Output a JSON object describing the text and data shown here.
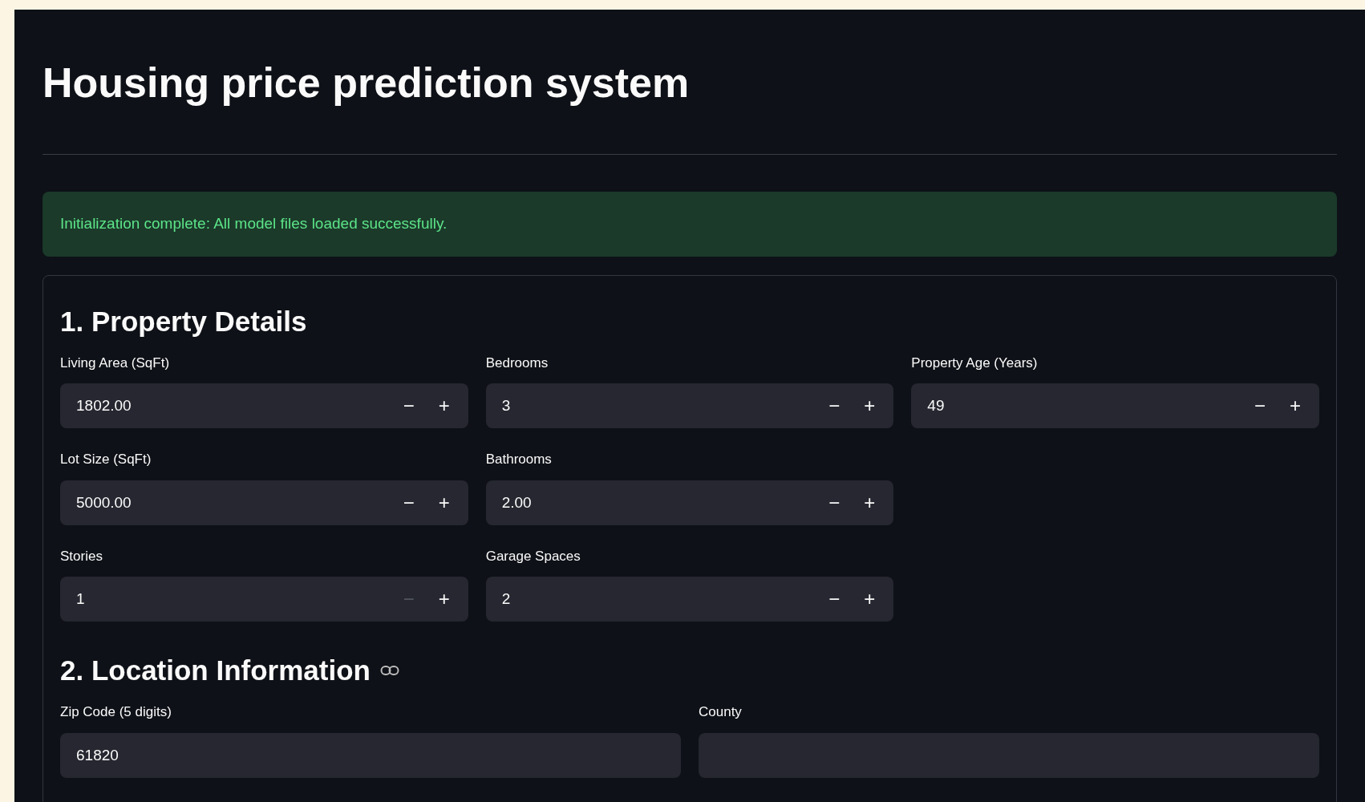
{
  "title": "Housing price prediction system",
  "alert": {
    "kind": "success",
    "text": "Initialization complete: All model files loaded successfully."
  },
  "sections": [
    {
      "heading": "1. Property Details",
      "anchor_link": false,
      "rows": [
        [
          {
            "kind": "number",
            "label": "Living Area (SqFt)",
            "value": "1802.00",
            "minus": "−",
            "plus": "+",
            "decrement_disabled": false
          },
          {
            "kind": "number",
            "label": "Bedrooms",
            "value": "3",
            "minus": "−",
            "plus": "+",
            "decrement_disabled": false
          },
          {
            "kind": "number",
            "label": "Property Age (Years)",
            "value": "49",
            "minus": "−",
            "plus": "+",
            "decrement_disabled": false
          }
        ],
        [
          {
            "kind": "number",
            "label": "Lot Size (SqFt)",
            "value": "5000.00",
            "minus": "−",
            "plus": "+",
            "decrement_disabled": false
          },
          {
            "kind": "number",
            "label": "Bathrooms",
            "value": "2.00",
            "minus": "−",
            "plus": "+",
            "decrement_disabled": false
          }
        ],
        [
          {
            "kind": "number",
            "label": "Stories",
            "value": "1",
            "minus": "−",
            "plus": "+",
            "decrement_disabled": true
          },
          {
            "kind": "number",
            "label": "Garage Spaces",
            "value": "2",
            "minus": "−",
            "plus": "+",
            "decrement_disabled": false
          }
        ]
      ]
    },
    {
      "heading": "2. Location Information",
      "anchor_link": true,
      "rows": [
        [
          {
            "kind": "text",
            "label": "Zip Code (5 digits)",
            "value": "61820"
          },
          {
            "kind": "text",
            "label": "County"
          }
        ]
      ]
    }
  ]
}
